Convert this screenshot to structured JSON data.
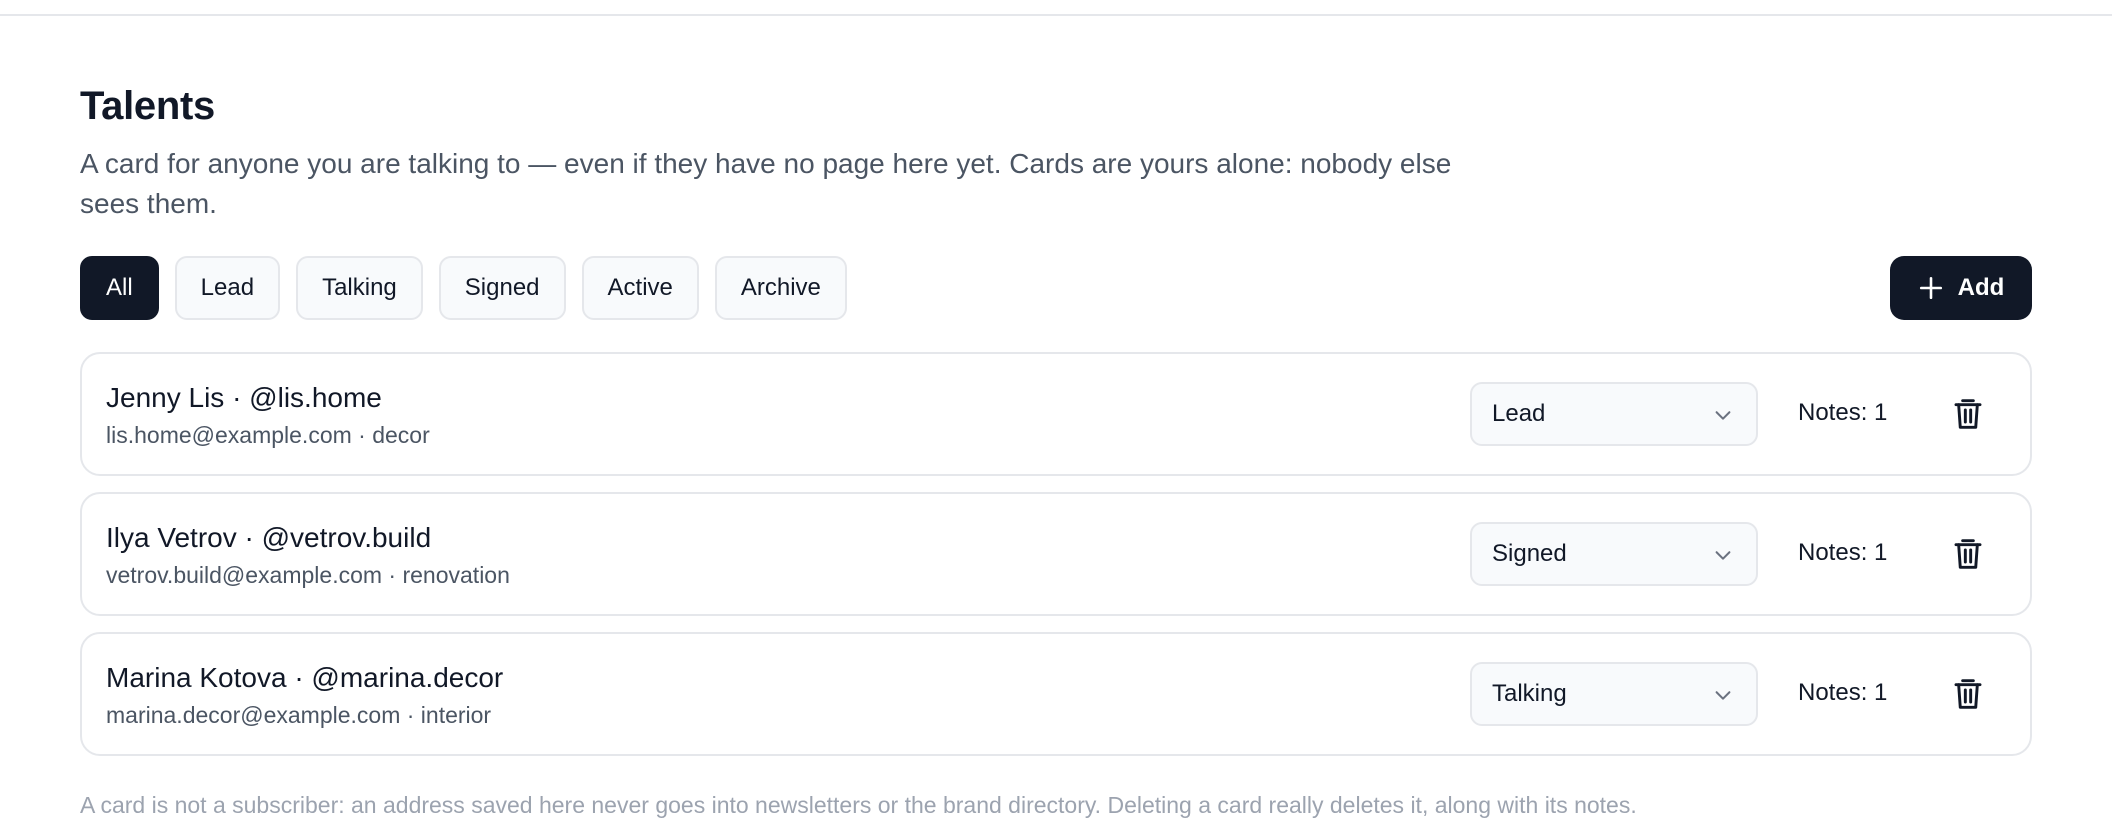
{
  "header": {
    "title": "Talents",
    "description": "A card for anyone you are talking to — even if they have no page here yet. Cards are yours alone: nobody else sees them."
  },
  "filters": [
    {
      "label": "All",
      "active": true
    },
    {
      "label": "Lead",
      "active": false
    },
    {
      "label": "Talking",
      "active": false
    },
    {
      "label": "Signed",
      "active": false
    },
    {
      "label": "Active",
      "active": false
    },
    {
      "label": "Archive",
      "active": false
    }
  ],
  "add_button": {
    "label": "Add",
    "icon": "plus-icon"
  },
  "talents": [
    {
      "title": "Jenny Lis · @lis.home",
      "meta": "lis.home@example.com · decor",
      "status": "Lead",
      "notes": "Notes: 1"
    },
    {
      "title": "Ilya Vetrov · @vetrov.build",
      "meta": "vetrov.build@example.com · renovation",
      "status": "Signed",
      "notes": "Notes: 1"
    },
    {
      "title": "Marina Kotova · @marina.decor",
      "meta": "marina.decor@example.com · interior",
      "status": "Talking",
      "notes": "Notes: 1"
    }
  ],
  "footnote": "A card is not a subscriber: an address saved here never goes into newsletters or the brand directory. Deleting a card really deletes it, along with its notes.",
  "colors": {
    "primary": "#111827",
    "border": "#e5e7eb",
    "muted": "#4b5563",
    "subtle": "#9ca3af"
  }
}
